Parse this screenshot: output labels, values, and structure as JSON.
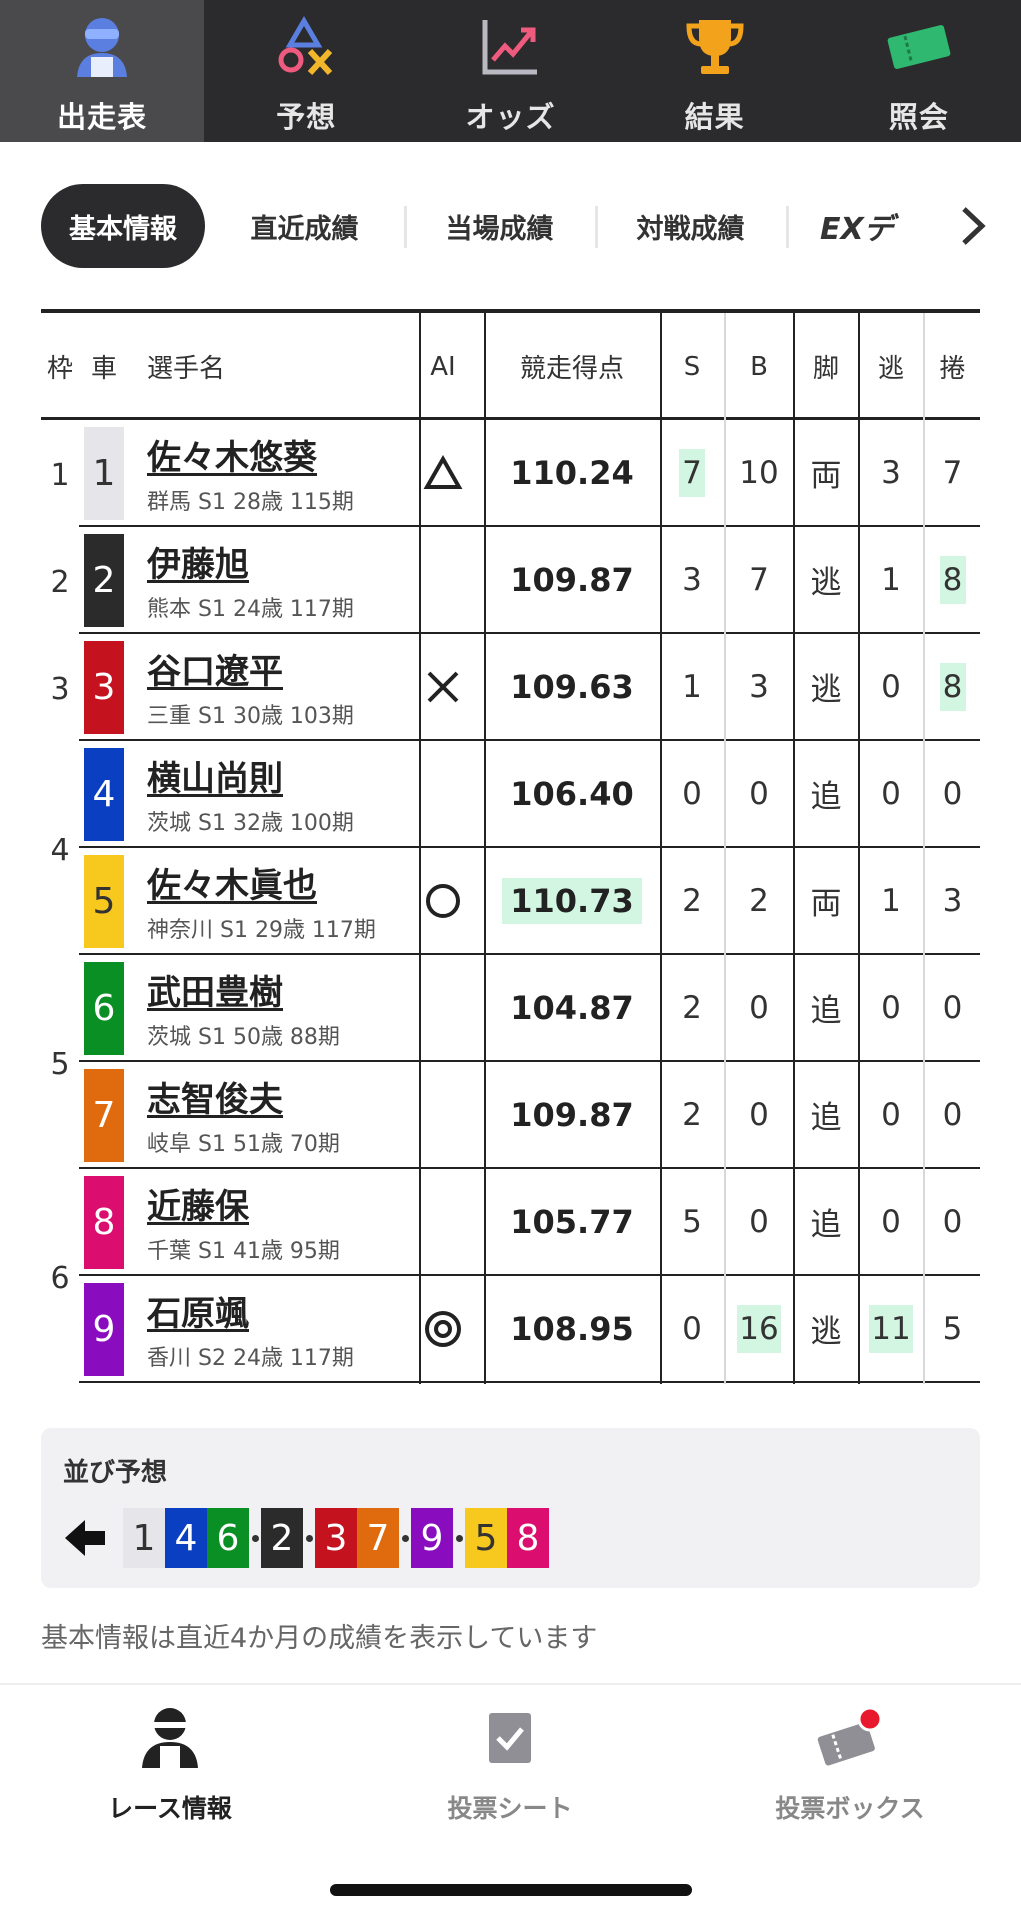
{
  "top_nav": [
    {
      "label": "出走表",
      "icon": "rider-icon",
      "active": true
    },
    {
      "label": "予想",
      "icon": "prediction-symbols-icon",
      "active": false
    },
    {
      "label": "オッズ",
      "icon": "trend-chart-icon",
      "active": false
    },
    {
      "label": "結果",
      "icon": "trophy-icon",
      "active": false
    },
    {
      "label": "照会",
      "icon": "ticket-icon",
      "active": false
    }
  ],
  "sub_tabs": {
    "active": "基本情報",
    "items": [
      "直近成績",
      "当場成績",
      "対戦成績",
      "EXデータ"
    ],
    "ex_visible": "EXデ"
  },
  "table": {
    "headers": {
      "waku": "枠",
      "car": "車",
      "name": "選手名",
      "ai": "AI",
      "score": "競走得点",
      "s": "S",
      "b": "B",
      "kyaku": "脚",
      "nige": "逃",
      "makuri": "捲"
    },
    "rows": [
      {
        "waku": "1",
        "car": "1",
        "car_bg": "#e6e6ea",
        "car_fg": "#333333",
        "name": "佐々木悠葵",
        "info": "群馬 S1 28歳 115期",
        "ai": "triangle",
        "score": "110.24",
        "score_hl": false,
        "s": "7",
        "s_hl": true,
        "b": "10",
        "b_hl": false,
        "kyaku": "両",
        "nige": "3",
        "nige_hl": false,
        "makuri": "7",
        "makuri_hl": false
      },
      {
        "waku": "2",
        "car": "2",
        "car_bg": "#2b2b2b",
        "car_fg": "#ffffff",
        "name": "伊藤旭",
        "info": "熊本 S1 24歳 117期",
        "ai": "",
        "score": "109.87",
        "score_hl": false,
        "s": "3",
        "s_hl": false,
        "b": "7",
        "b_hl": false,
        "kyaku": "逃",
        "nige": "1",
        "nige_hl": false,
        "makuri": "8",
        "makuri_hl": true
      },
      {
        "waku": "3",
        "car": "3",
        "car_bg": "#c4121f",
        "car_fg": "#ffffff",
        "name": "谷口遼平",
        "info": "三重 S1 30歳 103期",
        "ai": "cross",
        "score": "109.63",
        "score_hl": false,
        "s": "1",
        "s_hl": false,
        "b": "3",
        "b_hl": false,
        "kyaku": "逃",
        "nige": "0",
        "nige_hl": false,
        "makuri": "8",
        "makuri_hl": true
      },
      {
        "waku": "4",
        "car": "4",
        "car_bg": "#0a3fc2",
        "car_fg": "#ffffff",
        "name": "横山尚則",
        "info": "茨城 S1 32歳 100期",
        "ai": "",
        "score": "106.40",
        "score_hl": false,
        "s": "0",
        "s_hl": false,
        "b": "0",
        "b_hl": false,
        "kyaku": "追",
        "nige": "0",
        "nige_hl": false,
        "makuri": "0",
        "makuri_hl": false
      },
      {
        "waku": "4",
        "car": "5",
        "car_bg": "#f7c81e",
        "car_fg": "#333333",
        "name": "佐々木眞也",
        "info": "神奈川 S1 29歳 117期",
        "ai": "circle",
        "score": "110.73",
        "score_hl": true,
        "s": "2",
        "s_hl": false,
        "b": "2",
        "b_hl": false,
        "kyaku": "両",
        "nige": "1",
        "nige_hl": false,
        "makuri": "3",
        "makuri_hl": false
      },
      {
        "waku": "5",
        "car": "6",
        "car_bg": "#0a8f24",
        "car_fg": "#ffffff",
        "name": "武田豊樹",
        "info": "茨城 S1 50歳 88期",
        "ai": "",
        "score": "104.87",
        "score_hl": false,
        "s": "2",
        "s_hl": false,
        "b": "0",
        "b_hl": false,
        "kyaku": "追",
        "nige": "0",
        "nige_hl": false,
        "makuri": "0",
        "makuri_hl": false
      },
      {
        "waku": "5",
        "car": "7",
        "car_bg": "#e06b0e",
        "car_fg": "#ffffff",
        "name": "志智俊夫",
        "info": "岐阜 S1 51歳 70期",
        "ai": "",
        "score": "109.87",
        "score_hl": false,
        "s": "2",
        "s_hl": false,
        "b": "0",
        "b_hl": false,
        "kyaku": "追",
        "nige": "0",
        "nige_hl": false,
        "makuri": "0",
        "makuri_hl": false
      },
      {
        "waku": "6",
        "car": "8",
        "car_bg": "#db0d6e",
        "car_fg": "#ffffff",
        "name": "近藤保",
        "info": "千葉 S1 41歳 95期",
        "ai": "",
        "score": "105.77",
        "score_hl": false,
        "s": "5",
        "s_hl": false,
        "b": "0",
        "b_hl": false,
        "kyaku": "追",
        "nige": "0",
        "nige_hl": false,
        "makuri": "0",
        "makuri_hl": false
      },
      {
        "waku": "6",
        "car": "9",
        "car_bg": "#8a0cbf",
        "car_fg": "#ffffff",
        "name": "石原颯",
        "info": "香川 S2 24歳 117期",
        "ai": "double-circle",
        "score": "108.95",
        "score_hl": false,
        "s": "0",
        "s_hl": false,
        "b": "16",
        "b_hl": true,
        "kyaku": "逃",
        "nige": "11",
        "nige_hl": true,
        "makuri": "5",
        "makuri_hl": false
      }
    ]
  },
  "lineup": {
    "title": "並び予想",
    "groups": [
      [
        "1",
        "4",
        "6"
      ],
      [
        "2"
      ],
      [
        "3",
        "7"
      ],
      [
        "9"
      ],
      [
        "5",
        "8"
      ]
    ]
  },
  "note": "基本情報は直近4か月の成績を表示しています",
  "bottom_nav": [
    {
      "label": "レース情報",
      "icon": "rider-icon",
      "active": true
    },
    {
      "label": "投票シート",
      "icon": "checksheet-icon",
      "active": false
    },
    {
      "label": "投票ボックス",
      "icon": "ticket-box-icon",
      "active": false,
      "badge_color": "#e8192c"
    }
  ]
}
